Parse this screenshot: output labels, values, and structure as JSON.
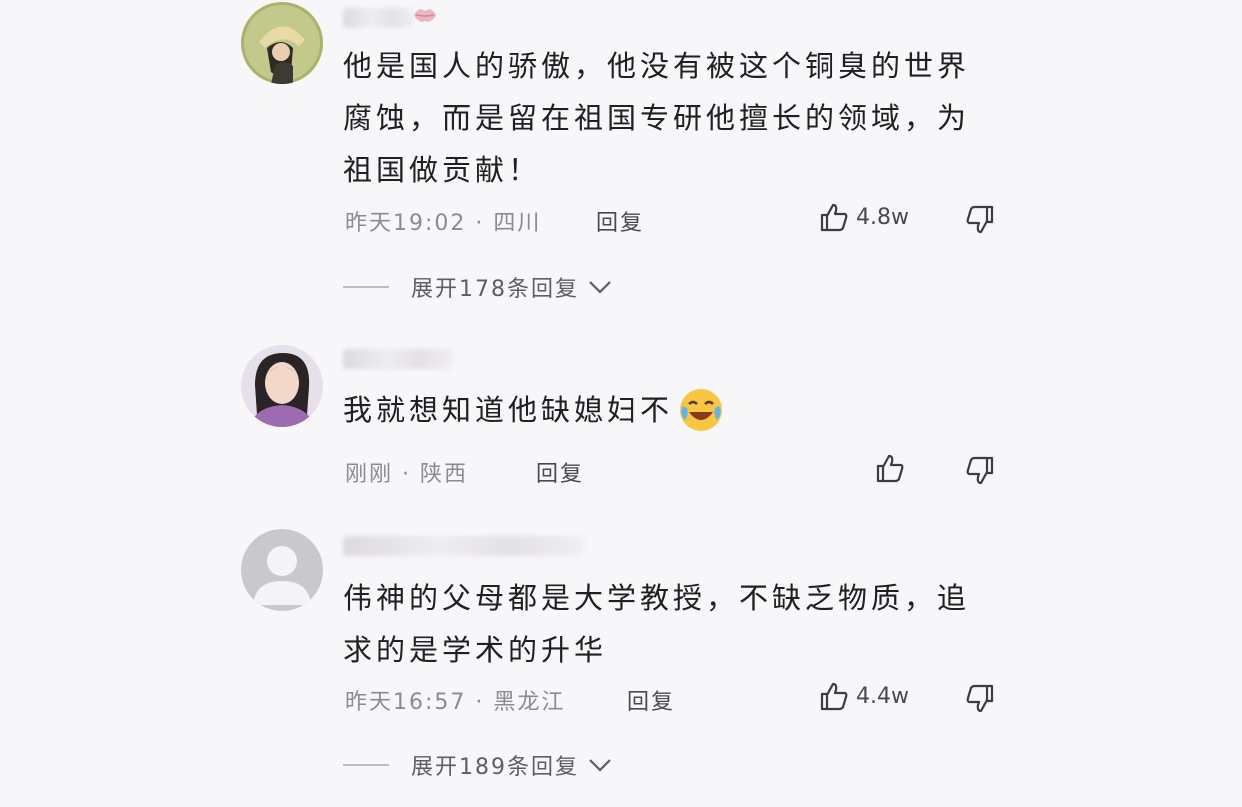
{
  "comments": [
    {
      "text": "他是国人的骄傲，他没有被这个铜臭的世界腐蚀，而是留在祖国专研他擅长的领域，为祖国做贡献！",
      "meta": "昨天19:02 · 四川",
      "reply_label": "回复",
      "like_count": "4.8w",
      "expand_label": "展开178条回复"
    },
    {
      "text": "我就想知道他缺媳妇不",
      "meta": "刚刚 · 陕西",
      "reply_label": "回复",
      "like_count": "",
      "emoji": "laughing-crying-emoji"
    },
    {
      "text": "伟神的父母都是大学教授，不缺乏物质，追求的是学术的升华",
      "meta": "昨天16:57 · 黑龙江",
      "reply_label": "回复",
      "like_count": "4.4w",
      "expand_label": "展开189条回复"
    }
  ],
  "icons": {
    "like": "thumbs-up-icon",
    "dislike": "thumbs-down-icon",
    "expand": "chevron-down-icon"
  },
  "colors": {
    "background": "#f7f6f8",
    "text": "#202020",
    "meta": "#8c8b90"
  }
}
